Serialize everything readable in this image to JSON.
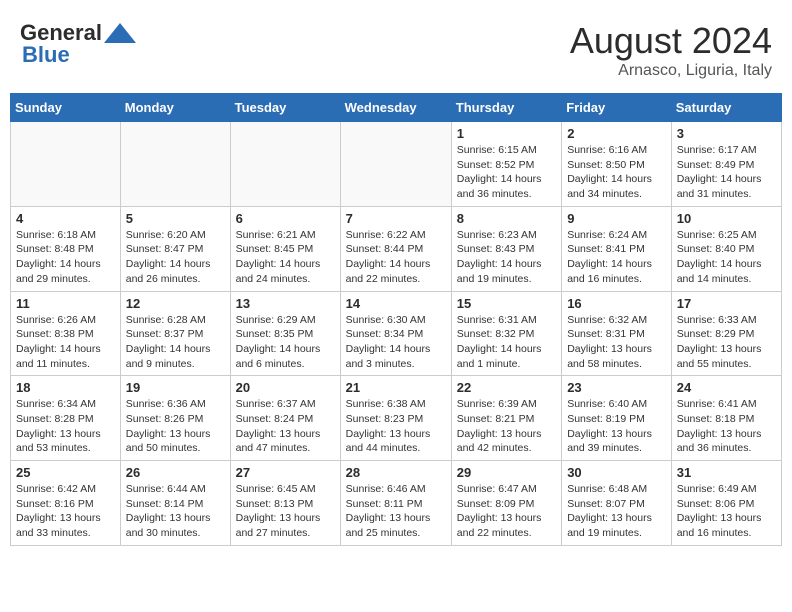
{
  "header": {
    "logo_general": "General",
    "logo_blue": "Blue",
    "month_year": "August 2024",
    "location": "Arnasco, Liguria, Italy"
  },
  "weekdays": [
    "Sunday",
    "Monday",
    "Tuesday",
    "Wednesday",
    "Thursday",
    "Friday",
    "Saturday"
  ],
  "weeks": [
    [
      {
        "day": "",
        "info": ""
      },
      {
        "day": "",
        "info": ""
      },
      {
        "day": "",
        "info": ""
      },
      {
        "day": "",
        "info": ""
      },
      {
        "day": "1",
        "info": "Sunrise: 6:15 AM\nSunset: 8:52 PM\nDaylight: 14 hours and 36 minutes."
      },
      {
        "day": "2",
        "info": "Sunrise: 6:16 AM\nSunset: 8:50 PM\nDaylight: 14 hours and 34 minutes."
      },
      {
        "day": "3",
        "info": "Sunrise: 6:17 AM\nSunset: 8:49 PM\nDaylight: 14 hours and 31 minutes."
      }
    ],
    [
      {
        "day": "4",
        "info": "Sunrise: 6:18 AM\nSunset: 8:48 PM\nDaylight: 14 hours and 29 minutes."
      },
      {
        "day": "5",
        "info": "Sunrise: 6:20 AM\nSunset: 8:47 PM\nDaylight: 14 hours and 26 minutes."
      },
      {
        "day": "6",
        "info": "Sunrise: 6:21 AM\nSunset: 8:45 PM\nDaylight: 14 hours and 24 minutes."
      },
      {
        "day": "7",
        "info": "Sunrise: 6:22 AM\nSunset: 8:44 PM\nDaylight: 14 hours and 22 minutes."
      },
      {
        "day": "8",
        "info": "Sunrise: 6:23 AM\nSunset: 8:43 PM\nDaylight: 14 hours and 19 minutes."
      },
      {
        "day": "9",
        "info": "Sunrise: 6:24 AM\nSunset: 8:41 PM\nDaylight: 14 hours and 16 minutes."
      },
      {
        "day": "10",
        "info": "Sunrise: 6:25 AM\nSunset: 8:40 PM\nDaylight: 14 hours and 14 minutes."
      }
    ],
    [
      {
        "day": "11",
        "info": "Sunrise: 6:26 AM\nSunset: 8:38 PM\nDaylight: 14 hours and 11 minutes."
      },
      {
        "day": "12",
        "info": "Sunrise: 6:28 AM\nSunset: 8:37 PM\nDaylight: 14 hours and 9 minutes."
      },
      {
        "day": "13",
        "info": "Sunrise: 6:29 AM\nSunset: 8:35 PM\nDaylight: 14 hours and 6 minutes."
      },
      {
        "day": "14",
        "info": "Sunrise: 6:30 AM\nSunset: 8:34 PM\nDaylight: 14 hours and 3 minutes."
      },
      {
        "day": "15",
        "info": "Sunrise: 6:31 AM\nSunset: 8:32 PM\nDaylight: 14 hours and 1 minute."
      },
      {
        "day": "16",
        "info": "Sunrise: 6:32 AM\nSunset: 8:31 PM\nDaylight: 13 hours and 58 minutes."
      },
      {
        "day": "17",
        "info": "Sunrise: 6:33 AM\nSunset: 8:29 PM\nDaylight: 13 hours and 55 minutes."
      }
    ],
    [
      {
        "day": "18",
        "info": "Sunrise: 6:34 AM\nSunset: 8:28 PM\nDaylight: 13 hours and 53 minutes."
      },
      {
        "day": "19",
        "info": "Sunrise: 6:36 AM\nSunset: 8:26 PM\nDaylight: 13 hours and 50 minutes."
      },
      {
        "day": "20",
        "info": "Sunrise: 6:37 AM\nSunset: 8:24 PM\nDaylight: 13 hours and 47 minutes."
      },
      {
        "day": "21",
        "info": "Sunrise: 6:38 AM\nSunset: 8:23 PM\nDaylight: 13 hours and 44 minutes."
      },
      {
        "day": "22",
        "info": "Sunrise: 6:39 AM\nSunset: 8:21 PM\nDaylight: 13 hours and 42 minutes."
      },
      {
        "day": "23",
        "info": "Sunrise: 6:40 AM\nSunset: 8:19 PM\nDaylight: 13 hours and 39 minutes."
      },
      {
        "day": "24",
        "info": "Sunrise: 6:41 AM\nSunset: 8:18 PM\nDaylight: 13 hours and 36 minutes."
      }
    ],
    [
      {
        "day": "25",
        "info": "Sunrise: 6:42 AM\nSunset: 8:16 PM\nDaylight: 13 hours and 33 minutes."
      },
      {
        "day": "26",
        "info": "Sunrise: 6:44 AM\nSunset: 8:14 PM\nDaylight: 13 hours and 30 minutes."
      },
      {
        "day": "27",
        "info": "Sunrise: 6:45 AM\nSunset: 8:13 PM\nDaylight: 13 hours and 27 minutes."
      },
      {
        "day": "28",
        "info": "Sunrise: 6:46 AM\nSunset: 8:11 PM\nDaylight: 13 hours and 25 minutes."
      },
      {
        "day": "29",
        "info": "Sunrise: 6:47 AM\nSunset: 8:09 PM\nDaylight: 13 hours and 22 minutes."
      },
      {
        "day": "30",
        "info": "Sunrise: 6:48 AM\nSunset: 8:07 PM\nDaylight: 13 hours and 19 minutes."
      },
      {
        "day": "31",
        "info": "Sunrise: 6:49 AM\nSunset: 8:06 PM\nDaylight: 13 hours and 16 minutes."
      }
    ]
  ]
}
